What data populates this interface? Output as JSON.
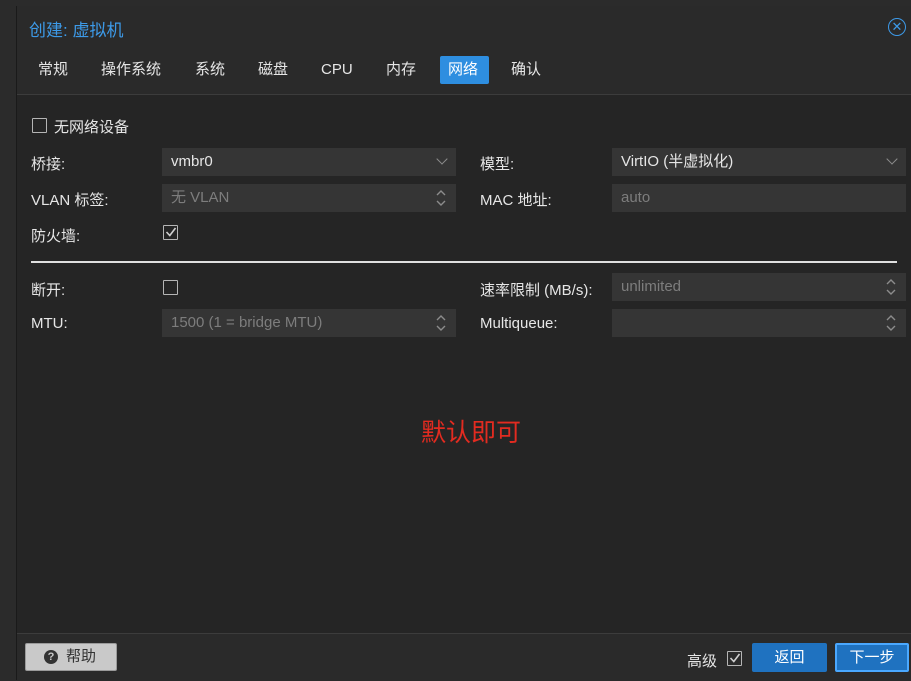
{
  "window": {
    "title": "创建: 虚拟机",
    "close_icon": "close-circle-icon"
  },
  "tabs": [
    {
      "label": "常规",
      "active": false
    },
    {
      "label": "操作系统",
      "active": false
    },
    {
      "label": "系统",
      "active": false
    },
    {
      "label": "磁盘",
      "active": false
    },
    {
      "label": "CPU",
      "active": false
    },
    {
      "label": "内存",
      "active": false
    },
    {
      "label": "网络",
      "active": true
    },
    {
      "label": "确认",
      "active": false
    }
  ],
  "form": {
    "no_network": {
      "label": "无网络设备",
      "checked": false
    },
    "bridge": {
      "label": "桥接:",
      "value": "vmbr0"
    },
    "model": {
      "label": "模型:",
      "value": "VirtIO (半虚拟化)"
    },
    "vlan": {
      "label": "VLAN 标签:",
      "placeholder": "无 VLAN"
    },
    "mac": {
      "label": "MAC 地址:",
      "placeholder": "auto"
    },
    "firewall": {
      "label": "防火墙:",
      "checked": true
    },
    "disconnect": {
      "label": "断开:",
      "checked": false
    },
    "rate_limit": {
      "label": "速率限制 (MB/s):",
      "placeholder": "unlimited"
    },
    "mtu": {
      "label": "MTU:",
      "placeholder": "1500 (1 = bridge MTU)"
    },
    "multiqueue": {
      "label": "Multiqueue:",
      "placeholder": ""
    }
  },
  "annotation": "默认即可",
  "footer": {
    "help_label": "帮助",
    "help_icon": "question-circle-icon",
    "advanced_label": "高级",
    "advanced_checked": true,
    "back_label": "返回",
    "next_label": "下一步"
  },
  "colors": {
    "accent": "#2e8ee0",
    "title": "#3d9ae8",
    "annotation": "#e32b20",
    "button": "#1f72c0"
  }
}
